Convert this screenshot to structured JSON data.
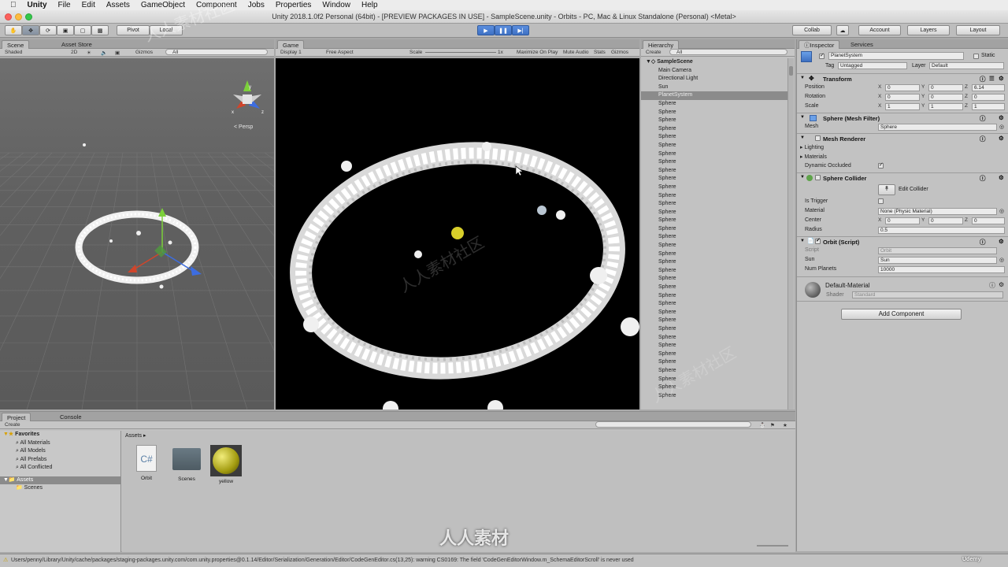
{
  "menubar": {
    "items": [
      "Unity",
      "File",
      "Edit",
      "Assets",
      "GameObject",
      "Component",
      "Jobs",
      "Properties",
      "Window",
      "Help"
    ]
  },
  "window_title": "Unity 2018.1.0f2 Personal (64bit) - [PREVIEW PACKAGES IN USE] - SampleScene.unity - Orbits - PC, Mac & Linux Standalone (Personal) <Metal>",
  "toolbar": {
    "pivot": "Pivot",
    "local": "Local",
    "collab": "Collab",
    "account": "Account",
    "layers": "Layers",
    "layout": "Layout"
  },
  "scene": {
    "tabs": [
      "Scene",
      "Asset Store"
    ],
    "shaded": "Shaded",
    "mode2d": "2D",
    "gizmos": "Gizmos",
    "search_placeholder": "All",
    "persp": "< Persp"
  },
  "game": {
    "tab": "Game",
    "display": "Display 1",
    "aspect": "Free Aspect",
    "scale_label": "Scale",
    "scale_value": "1x",
    "maximize": "Maximize On Play",
    "mute": "Mute Audio",
    "stats": "Stats",
    "gizmos": "Gizmos"
  },
  "hierarchy": {
    "tab": "Hierarchy",
    "create": "Create",
    "search_placeholder": "All",
    "scene_name": "SampleScene",
    "items": [
      "Main Camera",
      "Directional Light",
      "Sun",
      "PlanetSystem",
      "Sphere",
      "Sphere",
      "Sphere",
      "Sphere",
      "Sphere",
      "Sphere",
      "Sphere",
      "Sphere",
      "Sphere",
      "Sphere",
      "Sphere",
      "Sphere",
      "Sphere",
      "Sphere",
      "Sphere",
      "Sphere",
      "Sphere",
      "Sphere",
      "Sphere",
      "Sphere",
      "Sphere",
      "Sphere",
      "Sphere",
      "Sphere",
      "Sphere",
      "Sphere",
      "Sphere",
      "Sphere",
      "Sphere",
      "Sphere",
      "Sphere",
      "Sphere",
      "Sphere",
      "Sphere",
      "Sphere",
      "Sphere"
    ],
    "selected_index": 3
  },
  "inspector": {
    "tabs": [
      "Inspector",
      "Services"
    ],
    "object_name": "PlanetSystem",
    "static_label": "Static",
    "tag_label": "Tag",
    "tag_value": "Untagged",
    "layer_label": "Layer",
    "layer_value": "Default",
    "transform": {
      "title": "Transform",
      "position_label": "Position",
      "position": [
        "0",
        "0",
        "6.14"
      ],
      "rotation_label": "Rotation",
      "rotation": [
        "0",
        "0",
        "0"
      ],
      "scale_label": "Scale",
      "scale": [
        "1",
        "1",
        "1"
      ]
    },
    "mesh_filter": {
      "title": "Sphere (Mesh Filter)",
      "mesh_label": "Mesh",
      "mesh_value": "Sphere"
    },
    "mesh_renderer": {
      "title": "Mesh Renderer",
      "lighting": "Lighting",
      "materials": "Materials",
      "dynamic_occluded": "Dynamic Occluded"
    },
    "sphere_collider": {
      "title": "Sphere Collider",
      "edit_collider": "Edit Collider",
      "is_trigger": "Is Trigger",
      "material_label": "Material",
      "material_value": "None (Physic Material)",
      "center_label": "Center",
      "center": [
        "0",
        "0",
        "0"
      ],
      "radius_label": "Radius",
      "radius": "0.5"
    },
    "orbit": {
      "title": "Orbit (Script)",
      "script_label": "Script",
      "script_value": "Orbit",
      "sun_label": "Sun",
      "sun_value": "Sun",
      "num_planets_label": "Num Planets",
      "num_planets_value": "10000"
    },
    "material": {
      "name": "Default-Material",
      "shader_label": "Shader",
      "shader_value": "Standard"
    },
    "add_component": "Add Component"
  },
  "project": {
    "tabs": [
      "Project",
      "Console"
    ],
    "create": "Create",
    "favorites_title": "Favorites",
    "favorites": [
      "All Materials",
      "All Models",
      "All Prefabs",
      "All Conflicted"
    ],
    "assets_title": "Assets",
    "folders": [
      "Scenes"
    ],
    "breadcrumb": "Assets",
    "files": [
      {
        "name": "Orbit",
        "icon": "csharp-script-icon"
      },
      {
        "name": "Scenes",
        "icon": "folder-icon"
      },
      {
        "name": "yellow",
        "icon": "material-sphere-icon"
      }
    ]
  },
  "status": {
    "message": "Users/penny/Library/Unity/cache/packages/staging-packages.unity.com/com.unity.properties@0.1.14/Editor/Serialization/Generation/Editor/CodeGenEditor.cs(13,25): warning CS0169: The field 'CodeGenEditorWindow.m_SchemaEditorScroll' is never used"
  },
  "watermark": {
    "text": "人人素材社区",
    "logo_text": "人人素材",
    "udemy": "Udemy"
  },
  "colors": {
    "accent_play": "#4a7fd4",
    "selected_row": "#8b8b8b",
    "sun": "#c9c31e"
  }
}
